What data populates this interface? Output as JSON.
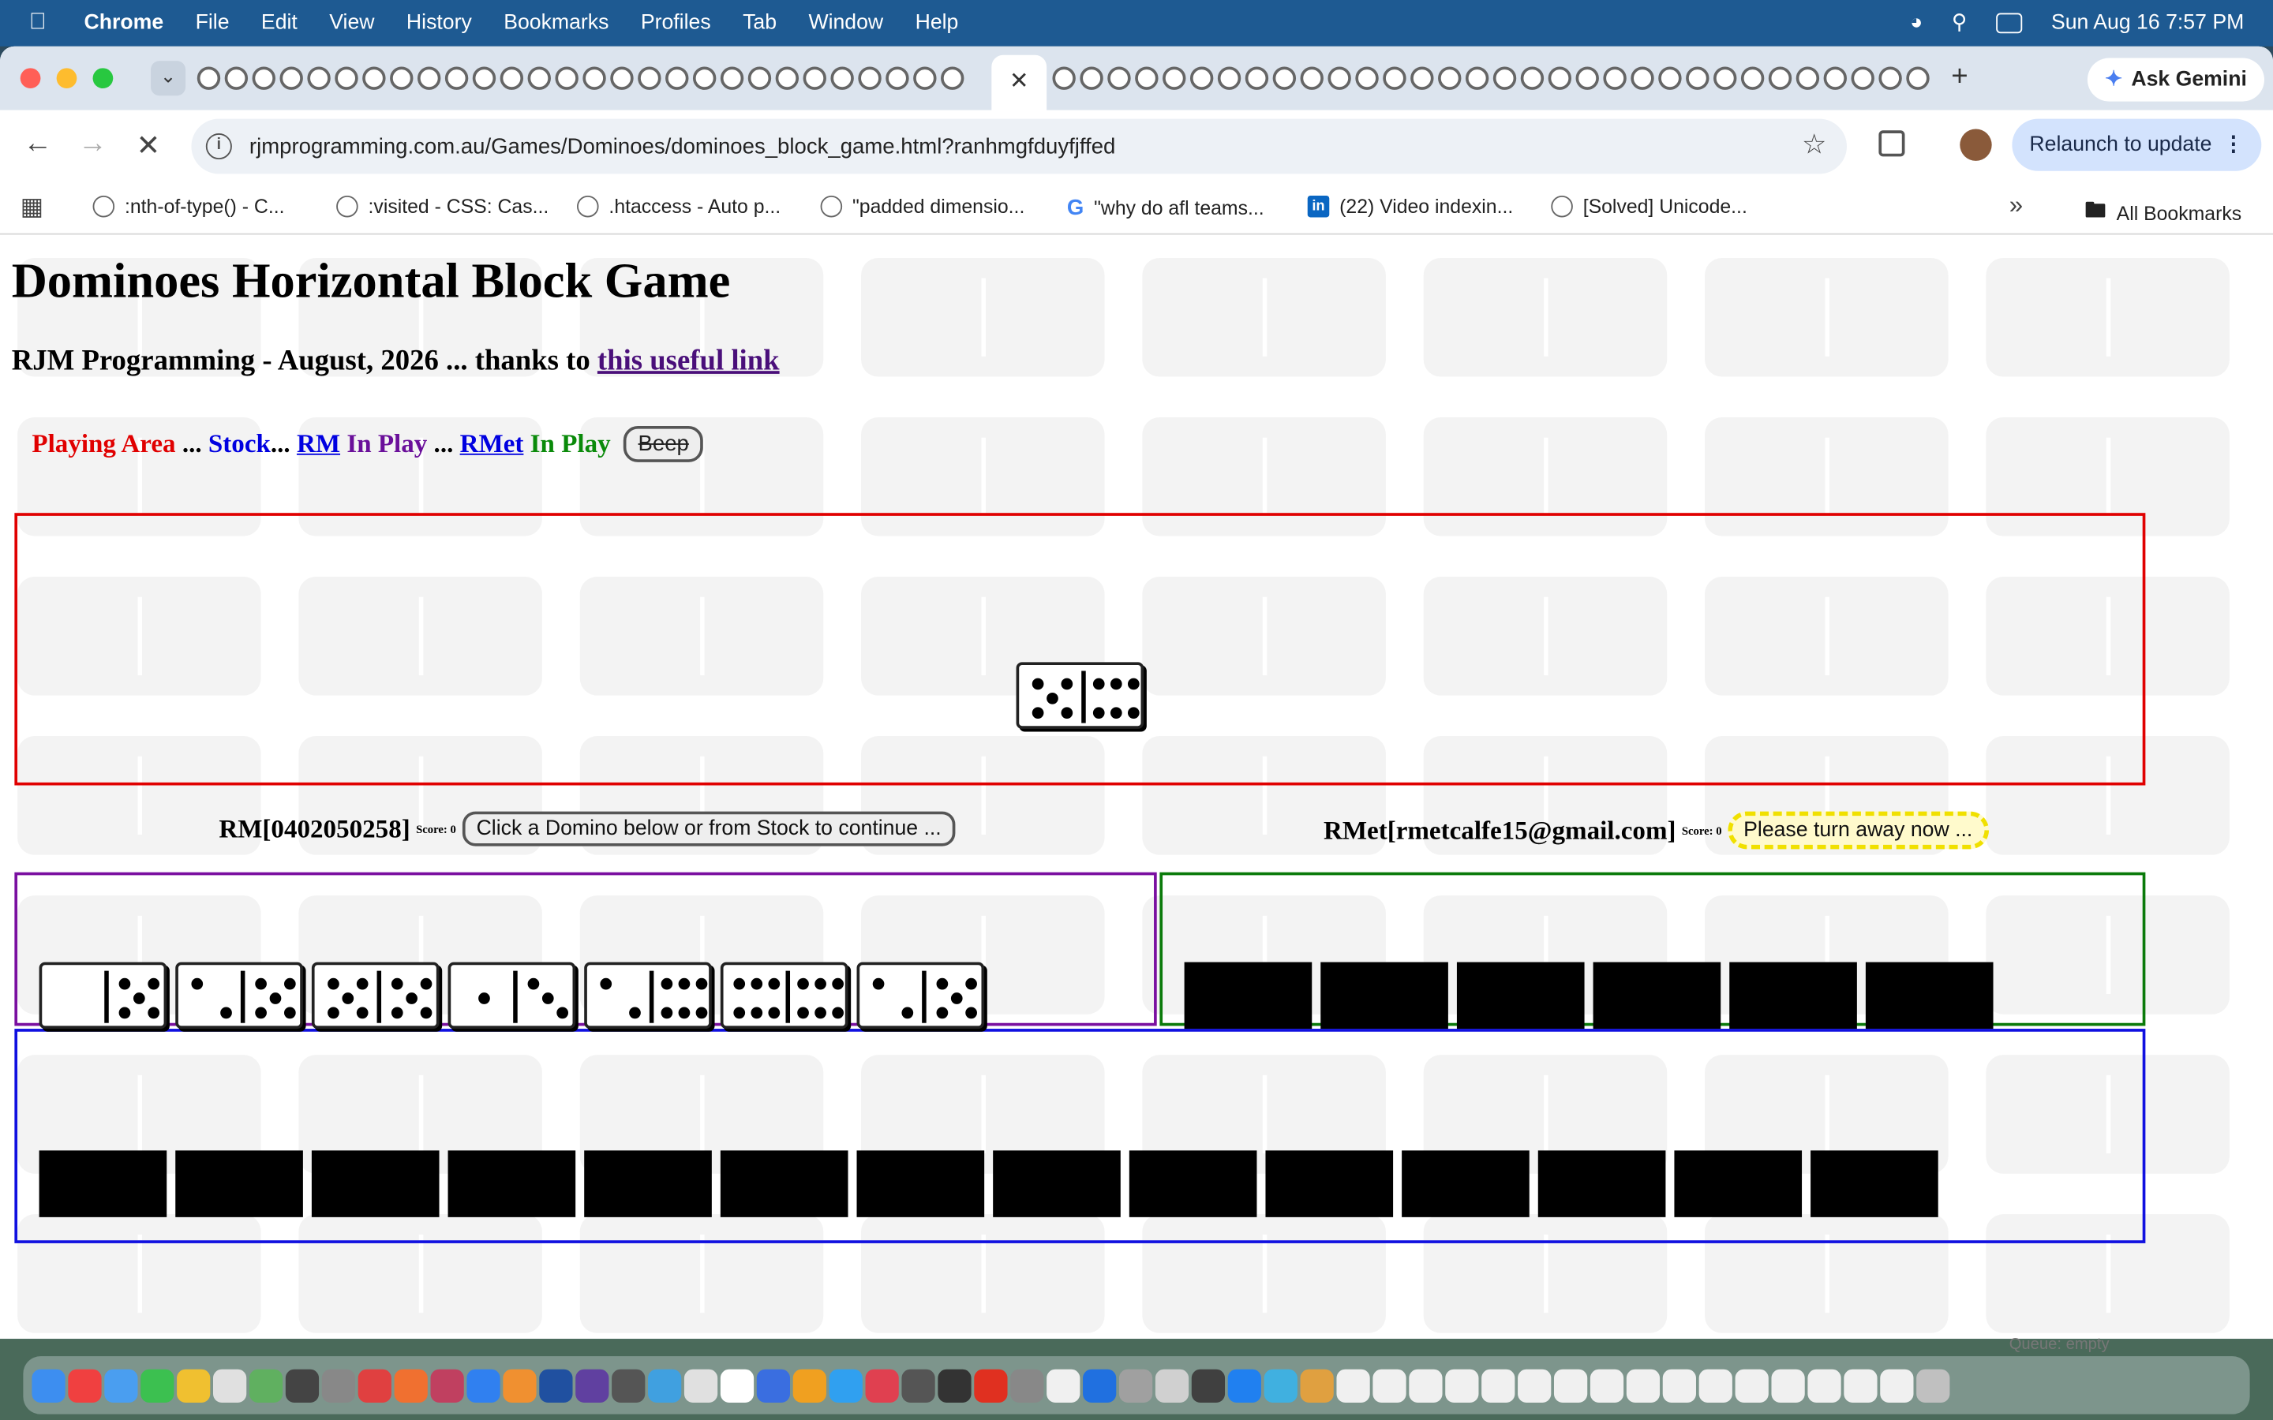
{
  "menubar": {
    "items": [
      "Chrome",
      "File",
      "Edit",
      "View",
      "History",
      "Bookmarks",
      "Profiles",
      "Tab",
      "Window",
      "Help"
    ],
    "datetime": "Sun Aug 16  7:57 PM"
  },
  "browser": {
    "url": "rjmprogramming.com.au/Games/Dominoes/dominoes_block_game.html?ranhmgfduyfjffed",
    "ask_gemini": "Ask Gemini",
    "relaunch": "Relaunch to update",
    "all_bookmarks": "All Bookmarks",
    "bookmarks": [
      {
        "label": ":nth-of-type() - C...",
        "icon": "globe-icon"
      },
      {
        "label": ":visited - CSS: Cas...",
        "icon": "globe-icon"
      },
      {
        "label": ".htaccess - Auto p...",
        "icon": "globe-icon"
      },
      {
        "label": "\"padded dimensio...",
        "icon": "globe-icon"
      },
      {
        "label": "\"why do afl teams...",
        "icon": "google-icon"
      },
      {
        "label": "(22) Video indexin...",
        "icon": "linkedin-icon"
      },
      {
        "label": "[Solved] Unicode...",
        "icon": "globe-icon"
      }
    ]
  },
  "page": {
    "title": "Dominoes Horizontal Block Game",
    "subtitle_prefix": "RJM Programming - August, 2026 ... thanks to ",
    "subtitle_link": "this useful link",
    "status": {
      "playing_area": "Playing Area",
      "sep1": " ... ",
      "stock": "Stock",
      "sep2": "... ",
      "rm_link": "RM",
      "rm_inplay": " In Play",
      "sep3": " ... ",
      "rmet_link": "RMet",
      "rmet_inplay": " In Play",
      "beep": "Beep"
    },
    "player1": {
      "name": "RM[0402050258]",
      "score_label": "Score: 0",
      "button": "Click a Domino below or from Stock to continue ..."
    },
    "player2": {
      "name": "RMet[rmetcalfe15@gmail.com]",
      "score_label": "Score: 0",
      "button": "Please turn away now ..."
    },
    "queue_text": "Queue: empty"
  },
  "game": {
    "played": [
      [
        5,
        6
      ]
    ],
    "rm_hand": [
      [
        0,
        5
      ],
      [
        2,
        5
      ],
      [
        5,
        5
      ],
      [
        1,
        3
      ],
      [
        2,
        6
      ],
      [
        6,
        6
      ],
      [
        2,
        5
      ]
    ],
    "rmet_hand_count": 6,
    "stock_count": 14
  },
  "colors": {
    "playing_area": "#e00000",
    "stock": "#0000e0",
    "rm": "#6a0f9a",
    "rmet": "#0a8a0a"
  }
}
